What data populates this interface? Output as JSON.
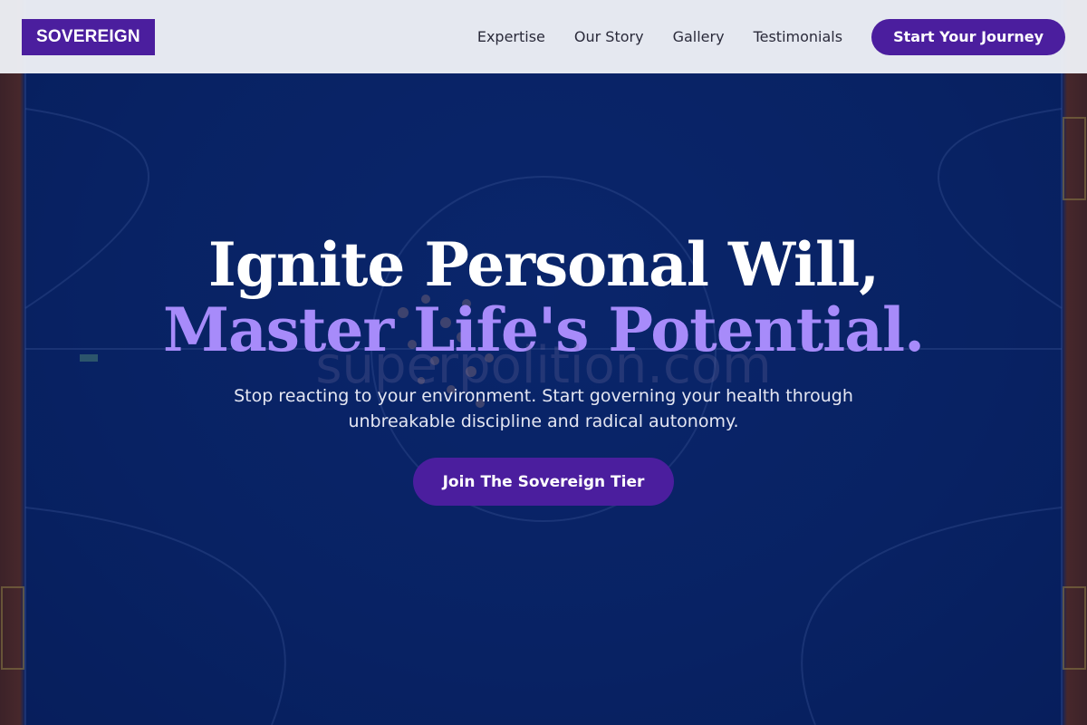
{
  "brand": {
    "logo_text": "SOVEREIGN"
  },
  "nav": {
    "items": [
      {
        "label": "Expertise"
      },
      {
        "label": "Our Story"
      },
      {
        "label": "Gallery"
      },
      {
        "label": "Testimonials"
      }
    ],
    "cta_label": "Start Your Journey"
  },
  "hero": {
    "headline_line1": "Ignite Personal Will,",
    "headline_line2": "Master Life's Potential.",
    "watermark": "superpolition.com",
    "subtext": "Stop reacting to your environment. Start governing your health through unbreakable discipline and radical autonomy.",
    "cta_label": "Join The Sovereign Tier"
  },
  "colors": {
    "brand_purple": "#4b1e9e",
    "accent_lavender": "#a78bfa",
    "hero_background": "#0a2a6e",
    "header_background": "#eef0f6"
  },
  "icons": []
}
